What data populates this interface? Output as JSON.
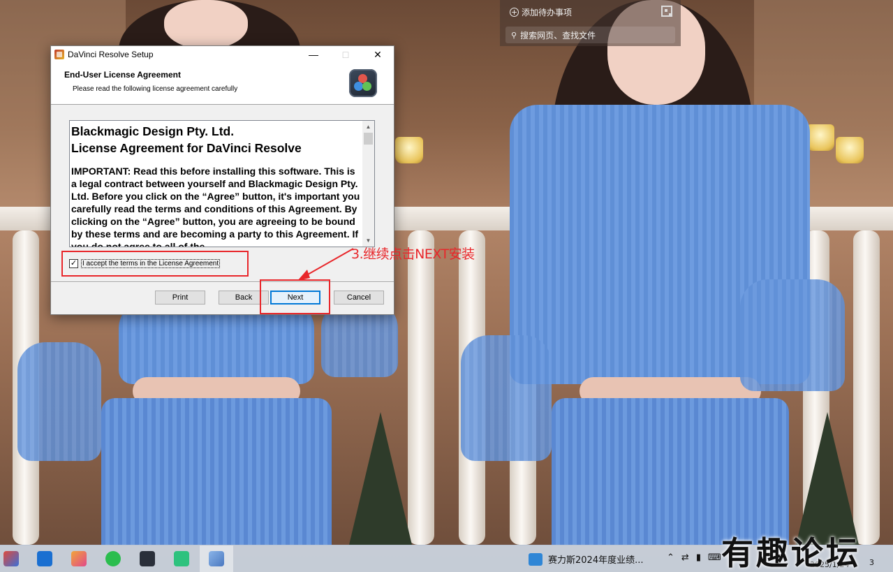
{
  "widget": {
    "add_todo": "添加待办事项",
    "search_placeholder": "搜索网页、查找文件"
  },
  "dialog": {
    "title": "DaVinci Resolve Setup",
    "header": "End-User License Agreement",
    "subheader": "Please read the following license agreement carefully",
    "license": {
      "company": "Blackmagic Design Pty. Ltd.",
      "heading": "License Agreement for DaVinci Resolve",
      "body": "IMPORTANT: Read this before installing this software. This is a legal contract between yourself and Blackmagic Design Pty. Ltd. Before you click on the “Agree” button, it's important you carefully read the terms and conditions of this Agreement. By clicking on the “Agree” button, you are agreeing to be bound by these terms and are becoming a party to this Agreement. If you do not agree to all of the"
    },
    "accept_label": "I accept the terms in the License Agreement",
    "accept_checked": true,
    "buttons": {
      "print": "Print",
      "back": "Back",
      "next": "Next",
      "cancel": "Cancel"
    }
  },
  "annotation": {
    "text": "3.继续点击NEXT安装",
    "color": "#e8262a"
  },
  "taskbar": {
    "notification": "赛力斯2024年度业绩...",
    "date": "2025/1/24",
    "badge": "3"
  },
  "watermark": "有趣论坛"
}
